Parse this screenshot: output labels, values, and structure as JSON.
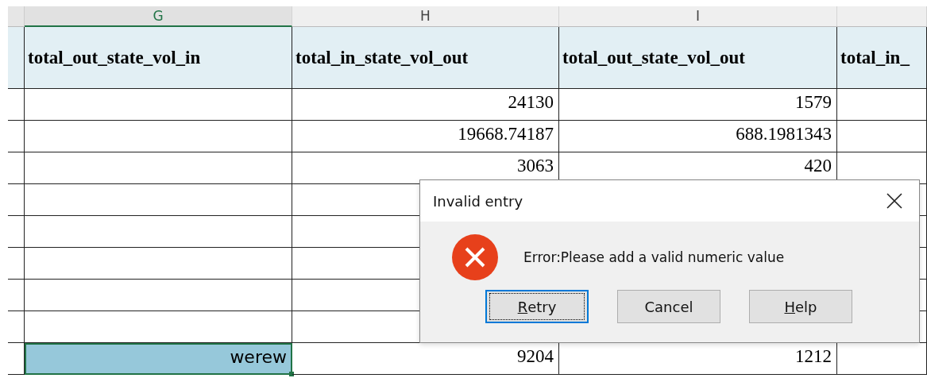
{
  "columns": [
    {
      "letter": "G",
      "selected": true,
      "heading": "total_out_state_vol_in"
    },
    {
      "letter": "H",
      "selected": false,
      "heading": "total_in_state_vol_out"
    },
    {
      "letter": "I",
      "selected": false,
      "heading": "total_out_state_vol_out"
    },
    {
      "selected": false,
      "heading": "total_in_"
    }
  ],
  "rows": [
    {
      "cells": [
        {
          "active": false
        },
        {
          "text": "24130",
          "active": false
        },
        {
          "text": "1579",
          "active": false
        },
        {
          "active": false
        }
      ]
    },
    {
      "cells": [
        {
          "active": false
        },
        {
          "text": "19668.74187",
          "active": false
        },
        {
          "text": "688.1981343",
          "active": false
        },
        {
          "active": false
        }
      ]
    },
    {
      "cells": [
        {
          "active": false
        },
        {
          "text": "3063",
          "active": false
        },
        {
          "text": "420",
          "active": false
        },
        {
          "active": false
        }
      ]
    },
    {
      "cells": [
        {
          "active": false
        },
        {
          "active": false
        },
        {},
        {
          "active": false
        }
      ]
    },
    {
      "cells": [
        {
          "active": false
        },
        {
          "active": false
        },
        {},
        {
          "active": false
        }
      ]
    },
    {
      "cells": [
        {
          "active": false
        },
        {
          "active": false
        },
        {},
        {
          "active": false
        }
      ]
    },
    {
      "cells": [
        {
          "active": false
        },
        {
          "active": false
        },
        {},
        {
          "active": false
        }
      ]
    },
    {
      "cells": [
        {
          "active": false
        },
        {
          "active": false
        },
        {},
        {
          "active": false
        }
      ]
    },
    {
      "cells": [
        {
          "text": "werew",
          "active": true
        },
        {
          "text": "9204",
          "active": false
        },
        {
          "text": "1212",
          "active": false
        },
        {
          "active": false
        }
      ]
    }
  ],
  "dialog": {
    "title": "Invalid entry",
    "message": "Error:Please add a valid numeric value",
    "buttons": [
      {
        "label": "Retry",
        "underline_first": true,
        "focused": true
      },
      {
        "label": "Cancel",
        "underline_first": false,
        "focused": false
      },
      {
        "label": "Help",
        "underline_first": true,
        "focused": false
      }
    ]
  }
}
